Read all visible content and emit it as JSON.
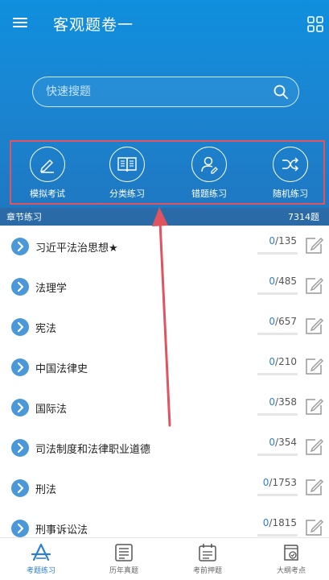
{
  "header": {
    "title": "客观题卷一",
    "menu_icon": "menu-icon",
    "grid_icon": "grid-icon"
  },
  "search": {
    "placeholder": "快速搜题",
    "value": ""
  },
  "features": [
    {
      "label": "模拟考试",
      "icon": "pen-icon"
    },
    {
      "label": "分类练习",
      "icon": "book-icon"
    },
    {
      "label": "错题练习",
      "icon": "user-edit-icon"
    },
    {
      "label": "随机练习",
      "icon": "shuffle-icon"
    }
  ],
  "section": {
    "label": "章节练习",
    "count": "7314题"
  },
  "chapters": [
    {
      "name": "习近平法治思想★",
      "done": "0",
      "total": "/135",
      "progress": 0
    },
    {
      "name": "法理学",
      "done": "0",
      "total": "/485",
      "progress": 0
    },
    {
      "name": "宪法",
      "done": "0",
      "total": "/657",
      "progress": 0
    },
    {
      "name": "中国法律史",
      "done": "0",
      "total": "/210",
      "progress": 0
    },
    {
      "name": "国际法",
      "done": "0",
      "total": "/358",
      "progress": 0
    },
    {
      "name": "司法制度和法律职业道德",
      "done": "0",
      "total": "/354",
      "progress": 0
    },
    {
      "name": "刑法",
      "done": "0",
      "total": "/1753",
      "progress": 0
    },
    {
      "name": "刑事诉讼法",
      "done": "0",
      "total": "/1815",
      "progress": 0
    }
  ],
  "bottom_nav": [
    {
      "label": "考题练习",
      "icon": "exam-practice-icon",
      "active": true
    },
    {
      "label": "历年真题",
      "icon": "past-papers-icon",
      "active": false
    },
    {
      "label": "考前押题",
      "icon": "calendar-icon",
      "active": false
    },
    {
      "label": "大纲考点",
      "icon": "outline-icon",
      "active": false
    }
  ],
  "colors": {
    "header_top": "#0f8fdd",
    "header_bottom": "#1f78c2",
    "accent": "#2f7fcf",
    "highlight": "#e05461",
    "section_bar": "#2a6aa6"
  }
}
